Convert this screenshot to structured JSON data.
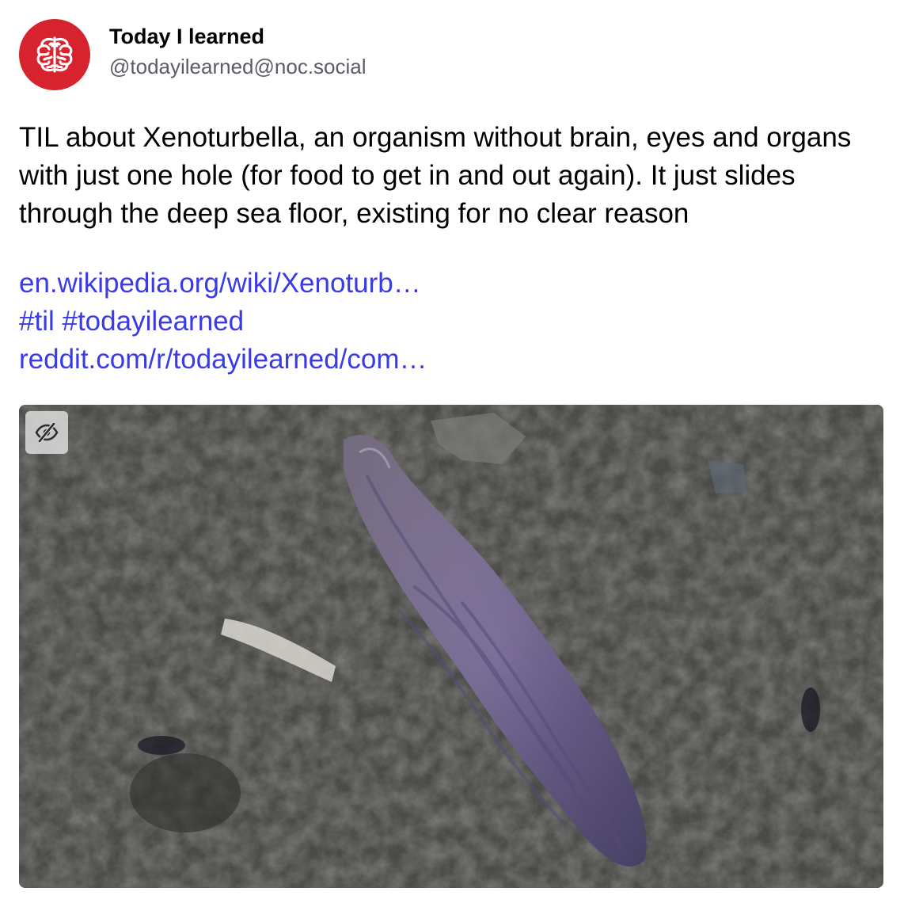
{
  "account": {
    "display_name": "Today I learned",
    "handle": "@todayilearned@noc.social",
    "avatar_icon": "brain-icon",
    "avatar_color": "#d7232d"
  },
  "post": {
    "text": "TIL about Xenoturbella, an organism without brain, eyes and organs with just one hole (for food to get in and out again). It just slides through the deep sea floor, existing for no clear reason",
    "link_wikipedia": "en.wikipedia.org/wiki/Xenoturb…",
    "hashtag_til": "#til",
    "hashtag_todayilearned": "#todayilearned",
    "link_reddit": "reddit.com/r/todayilearned/com…",
    "link_color": "#3a3ae6"
  },
  "media": {
    "hide_icon": "eye-slash-icon"
  }
}
